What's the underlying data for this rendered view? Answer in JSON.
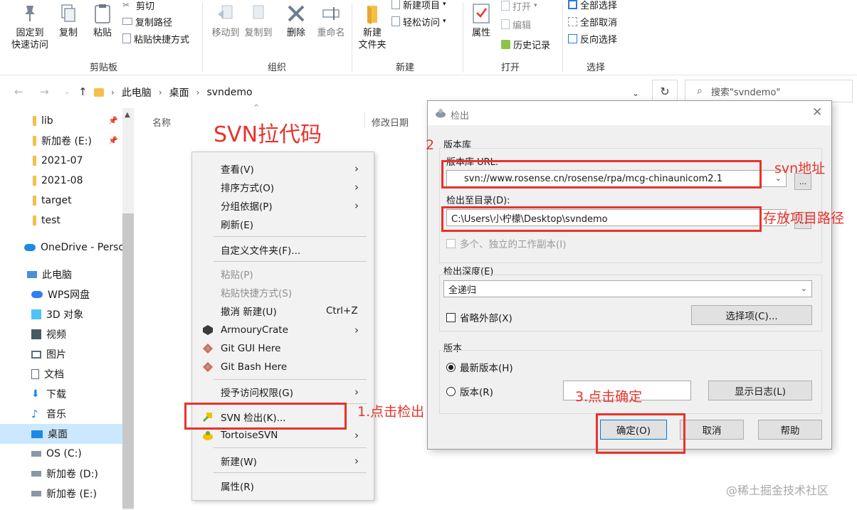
{
  "ribbon": {
    "clipboard": {
      "pin_label_1": "固定到",
      "pin_label_2": "快速访问",
      "copy": "复制",
      "paste": "粘贴",
      "cut": "剪切",
      "copy_path": "复制路径",
      "paste_shortcut": "粘贴快捷方式",
      "group": "剪贴板"
    },
    "organize": {
      "move_to": "移动到",
      "copy_to": "复制到",
      "delete": "删除",
      "rename": "重命名",
      "group": "组织"
    },
    "new": {
      "new_folder_1": "新建",
      "new_folder_2": "文件夹",
      "new_item": "新建项目",
      "easy_access": "轻松访问",
      "group": "新建"
    },
    "open": {
      "properties": "属性",
      "open": "打开",
      "edit": "编辑",
      "history": "历史记录",
      "group": "打开"
    },
    "select": {
      "select_all": "全部选择",
      "select_none": "全部取消",
      "invert": "反向选择",
      "group": "选择"
    }
  },
  "address": {
    "crumbs": [
      "此电脑",
      "桌面",
      "svndemo"
    ],
    "search_placeholder": "搜索\"svndemo\""
  },
  "navpane": {
    "items": [
      {
        "label": "lib",
        "icon": "folder-icon"
      },
      {
        "label": "新加卷 (E:)",
        "icon": "drive-icon"
      },
      {
        "label": "2021-07",
        "icon": "folder-icon"
      },
      {
        "label": "2021-08",
        "icon": "folder-icon"
      },
      {
        "label": "target",
        "icon": "folder-icon"
      },
      {
        "label": "test",
        "icon": "folder-icon"
      },
      {
        "label": "OneDrive - Perso",
        "icon": "cloud-icon"
      },
      {
        "label": "此电脑",
        "icon": "computer-icon"
      },
      {
        "label": "WPS网盘",
        "icon": "cloud-icon"
      },
      {
        "label": "3D 对象",
        "icon": "cube-icon"
      },
      {
        "label": "视频",
        "icon": "video-icon"
      },
      {
        "label": "图片",
        "icon": "picture-icon"
      },
      {
        "label": "文档",
        "icon": "document-icon"
      },
      {
        "label": "下载",
        "icon": "download-icon"
      },
      {
        "label": "音乐",
        "icon": "music-icon"
      },
      {
        "label": "桌面",
        "icon": "desktop-icon"
      },
      {
        "label": "OS (C:)",
        "icon": "drive-icon"
      },
      {
        "label": "新加卷 (D:)",
        "icon": "drive-icon"
      },
      {
        "label": "新加卷 (E:)",
        "icon": "drive-icon"
      }
    ]
  },
  "content": {
    "col_name": "名称",
    "col_modified": "修改日期"
  },
  "context_menu": {
    "items": [
      {
        "label": "查看(V)"
      },
      {
        "label": "排序方式(O)"
      },
      {
        "label": "分组依据(P)"
      },
      {
        "label": "刷新(E)"
      },
      {
        "label": "自定义文件夹(F)..."
      },
      {
        "label": "粘贴(P)"
      },
      {
        "label": "粘贴快捷方式(S)"
      },
      {
        "label": "撤消 新建(U)",
        "shortcut": "Ctrl+Z"
      },
      {
        "label": "ArmouryCrate"
      },
      {
        "label": "Git GUI Here"
      },
      {
        "label": "Git Bash Here"
      },
      {
        "label": "授予访问权限(G)"
      },
      {
        "label": "SVN 检出(K)..."
      },
      {
        "label": "TortoiseSVN"
      },
      {
        "label": "新建(W)"
      },
      {
        "label": "属性(R)"
      }
    ]
  },
  "dialog": {
    "title": "检出",
    "repo_group": "版本库",
    "repo_url_label": "版本库 URL:",
    "repo_url": "svn://www.rosense.cn/rosense/rpa/mcg-chinaunicom2.1",
    "checkout_dir_label": "检出至目录(D):",
    "checkout_dir": "C:\\Users\\小柠檬\\Desktop\\svndemo",
    "browse": "...",
    "multi_wc": "多个、独立的工作副本(I)",
    "depth_group": "检出深度(E)",
    "depth_value": "全递归",
    "omit_externals": "省略外部(X)",
    "choose_items": "选择项(C)...",
    "revision_group": "版本",
    "head_revision": "最新版本(H)",
    "revision": "版本(R)",
    "show_log": "显示日志(L)",
    "ok": "确定(O)",
    "cancel": "取消",
    "help": "帮助"
  },
  "annotations": {
    "title": "SVN拉代码",
    "step1": "1.点击检出",
    "step2": "2",
    "svn_addr": "svn地址",
    "store_path": "存放项目路径",
    "step3": "3.点击确定"
  },
  "watermark": "@稀土掘金技术社区",
  "colors": {
    "annotation_red": "#e8332b",
    "selection_blue": "#cce8ff",
    "folder_yellow": "#f5c04a"
  }
}
